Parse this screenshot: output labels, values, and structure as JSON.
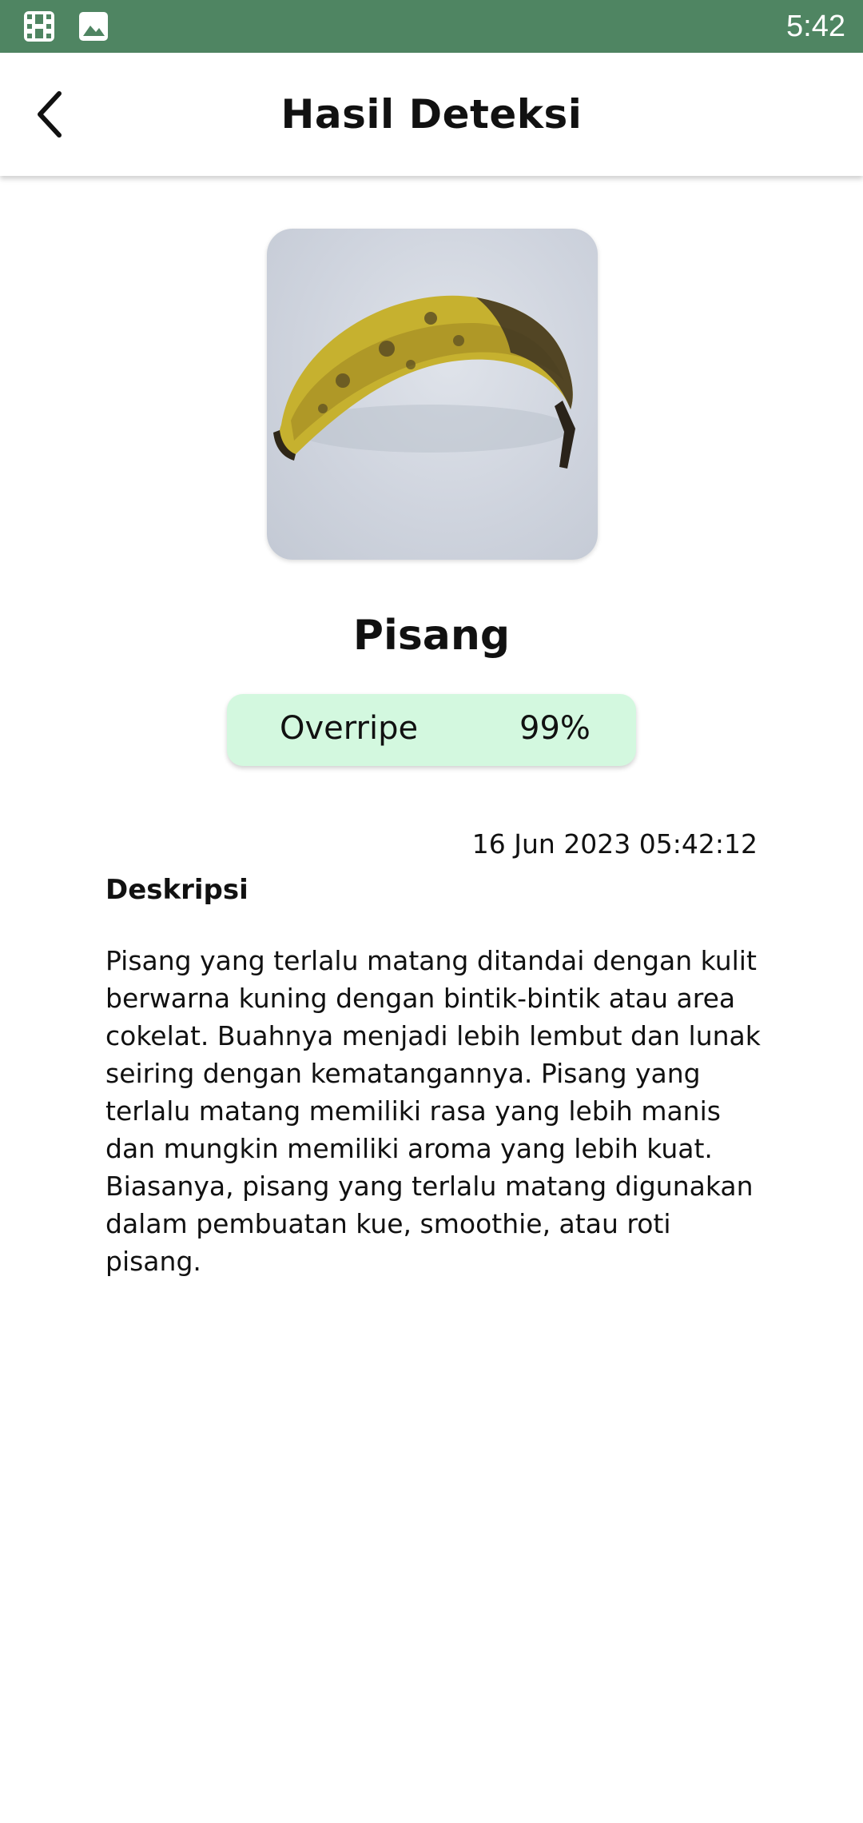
{
  "status_bar": {
    "time": "5:42",
    "icons": [
      "film-icon",
      "image-icon"
    ],
    "background_color": "#4f8562"
  },
  "app_bar": {
    "title": "Hasil Deteksi",
    "back_icon": "chevron-left-icon"
  },
  "result": {
    "fruit_name": "Pisang",
    "ripeness_label": "Overripe",
    "confidence": "99%",
    "pill_color": "#d3f8df"
  },
  "detail": {
    "timestamp": "16 Jun 2023 05:42:12",
    "description_heading": "Deskripsi",
    "description_text": "Pisang yang terlalu matang ditandai dengan kulit berwarna kuning dengan bintik-bintik atau area cokelat. Buahnya menjadi lebih lembut dan lunak seiring dengan kematangannya. Pisang yang terlalu matang memiliki rasa yang lebih manis dan mungkin memiliki aroma yang lebih kuat. Biasanya, pisang yang terlalu matang digunakan dalam pembuatan kue, smoothie, atau roti pisang."
  }
}
